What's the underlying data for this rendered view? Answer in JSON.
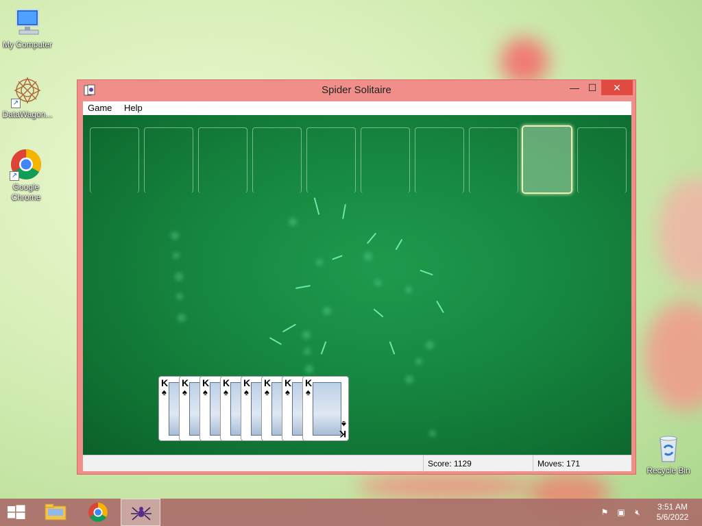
{
  "desktop": {
    "icons": [
      {
        "label": "My Computer"
      },
      {
        "label": "DataWagon..."
      },
      {
        "label": "Google Chrome"
      },
      {
        "label": "Recycle Bin"
      }
    ]
  },
  "window": {
    "title": "Spider Solitaire",
    "controls": {
      "minimize": "—",
      "maximize": "☐",
      "close": "✕"
    },
    "menu": [
      "Game",
      "Help"
    ],
    "status": {
      "score_label": "Score:",
      "score_value": "1129",
      "moves_label": "Moves:",
      "moves_value": "171"
    },
    "foundation_slots": 10,
    "completed_run": {
      "cards": [
        {
          "rank": "K",
          "suit": "♠"
        },
        {
          "rank": "K",
          "suit": "♠"
        },
        {
          "rank": "K",
          "suit": "♠"
        },
        {
          "rank": "K",
          "suit": "♠"
        },
        {
          "rank": "K",
          "suit": "♠"
        },
        {
          "rank": "K",
          "suit": "♠"
        },
        {
          "rank": "K",
          "suit": "♠"
        },
        {
          "rank": "K",
          "suit": "♠"
        }
      ]
    }
  },
  "taskbar": {
    "clock_time": "3:51 AM",
    "clock_date": "5/6/2022"
  },
  "colors": {
    "felt": "#16863f",
    "window_border": "#f08f8a",
    "taskbar": "#aa6e69",
    "close_button": "#e04a40"
  }
}
